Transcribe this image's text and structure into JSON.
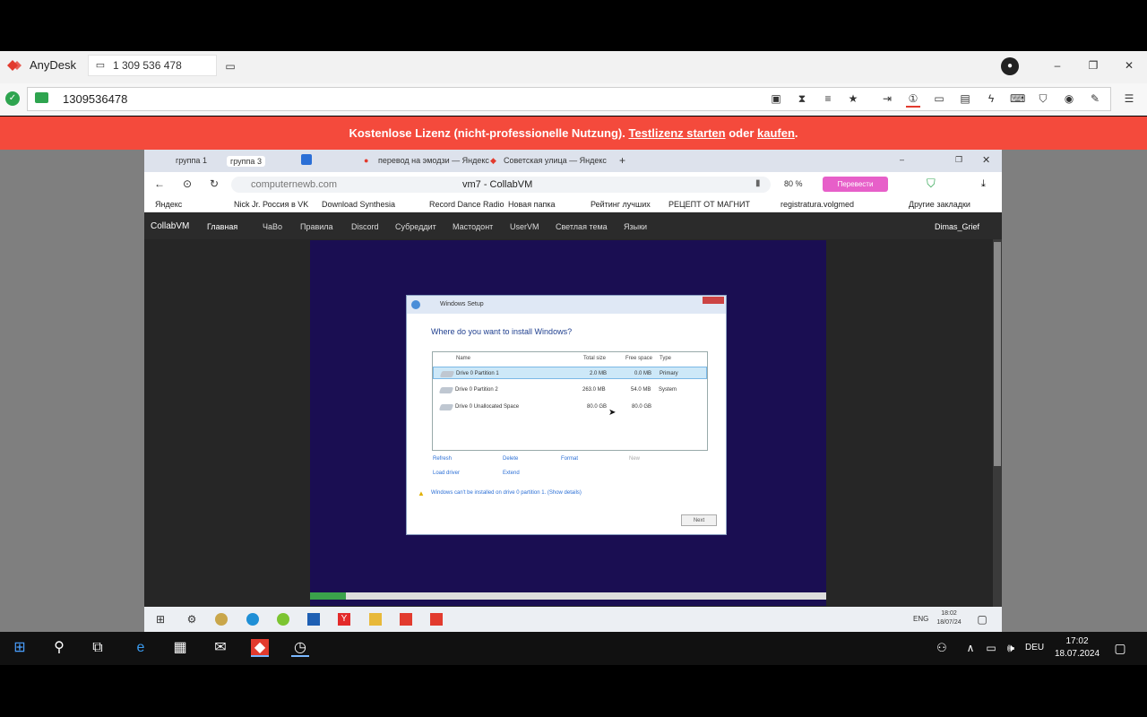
{
  "anydesk": {
    "app_name": "AnyDesk",
    "tab_label": "1 309 536 478",
    "address": "1309536478",
    "banner": {
      "text_a": "Kostenlose Lizenz (nicht-professionelle Nutzung). ",
      "link_trial": "Testlizenz starten",
      "text_b": " oder ",
      "link_buy": "kaufen",
      "text_c": "."
    }
  },
  "browser": {
    "tabs": [
      "группа 1",
      "группа 3",
      "перевод на эмодзи — Яндекс",
      "Советская улица — Яндекс"
    ],
    "url_domain": "computernewb.com",
    "page_title": "vm7 - CollabVM",
    "zoom": "80 %",
    "translate_btn": "Перевести",
    "bookmarks": [
      "Яндекс",
      "Nick Jr. Россия в VK",
      "Download Synthesia",
      "Record Dance Radio",
      "Новая папка",
      "Рейтинг лучших",
      "РЕЦЕПТ ОТ МАГНИТ",
      "registratura.volgmed",
      "Другие закладки"
    ]
  },
  "collabvm": {
    "brand": "CollabVM",
    "nav": [
      "Главная",
      "ЧаВо",
      "Правила",
      "Discord",
      "Субреддит",
      "Мастодонт",
      "UserVM",
      "Светлая тема",
      "Языки"
    ],
    "user": "Dimas_Grief"
  },
  "setup": {
    "title": "Windows Setup",
    "question": "Where do you want to install Windows?",
    "columns": [
      "Name",
      "Total size",
      "Free space",
      "Type"
    ],
    "rows": [
      {
        "name": "Drive 0 Partition 1",
        "total": "2.0 MB",
        "free": "0.0 MB",
        "type": "Primary"
      },
      {
        "name": "Drive 0 Partition 2",
        "total": "263.0 MB",
        "free": "54.0 MB",
        "type": "System"
      },
      {
        "name": "Drive 0 Unallocated Space",
        "total": "80.0 GB",
        "free": "80.0 GB",
        "type": ""
      }
    ],
    "actions": {
      "refresh": "Refresh",
      "delete": "Delete",
      "format": "Format",
      "new": "New",
      "load_driver": "Load driver",
      "extend": "Extend"
    },
    "warning": "Windows can't be installed on drive 0 partition 1.  (Show details)",
    "next": "Next"
  },
  "remote_taskbar": {
    "lang": "ENG",
    "time": "18:02",
    "date": "18/07/24"
  },
  "local_taskbar": {
    "lang": "DEU",
    "time": "17:02",
    "date": "18.07.2024"
  },
  "colors": {
    "banner": "#f44a3c",
    "vm_bg": "#1a0e52",
    "selected_row": "#cde8f8"
  }
}
